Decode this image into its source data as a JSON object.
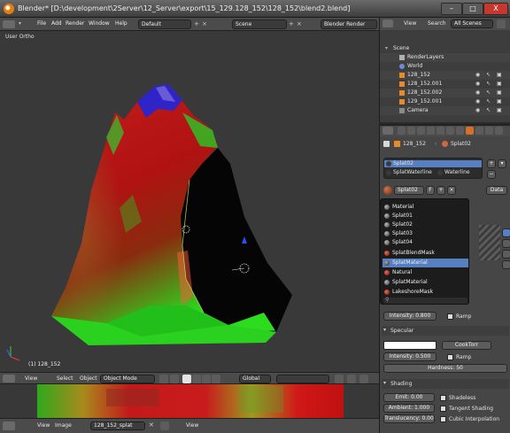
{
  "titlebar": {
    "title": "Blender* [D:\\development\\2Server\\12_Server\\export\\15_129.128_152\\128_152\\blend2.blend]",
    "minimize": "–",
    "maximize": "□",
    "close": "X"
  },
  "menubar": {
    "items": [
      "File",
      "Add",
      "Render",
      "Window",
      "Help"
    ],
    "layout": "Default",
    "scene": "Scene",
    "engine": "Blender Render"
  },
  "viewport": {
    "label": "User Ortho",
    "object_name": "(1) 128_152"
  },
  "view_header": {
    "view": "View",
    "select": "Select",
    "object": "Object",
    "mode": "Object Mode",
    "global": "Global"
  },
  "image_header": {
    "view": "View",
    "image": "Image",
    "image_name": "128_152_splat",
    "view2": "View"
  },
  "outliner": {
    "header": {
      "search": "Search",
      "filter": "All Scenes",
      "view": "View"
    },
    "rows": [
      {
        "label": "Scene"
      },
      {
        "label": "RenderLayers"
      },
      {
        "label": "World"
      },
      {
        "label": "128_152"
      },
      {
        "label": "128_152.001"
      },
      {
        "label": "128_152.002"
      },
      {
        "label": "129_152.001"
      },
      {
        "label": "Camera"
      }
    ]
  },
  "properties": {
    "breadcrumb_object": "128_152",
    "breadcrumb_material": "Splat02",
    "slots": [
      "Splat02",
      "SplatWaterline",
      "Waterline"
    ],
    "material_field": "Splat02",
    "data_btn": "Data",
    "intensity": "Intensity: 0.800",
    "ramp": "Ramp",
    "specular_label": "Specular",
    "specular_shader": "CookTorr",
    "specular_intensity": "Intensity: 0.500",
    "hardness": "Hardness: 50",
    "shading_label": "Shading",
    "emit": "Emit: 0.00",
    "ambient": "Ambient: 1.000",
    "translucency": "Translucency: 0.000",
    "shadeless": "Shadeless",
    "tangent_shading": "Tangent Shading",
    "cubic": "Cubic Interpolation"
  },
  "material_list": [
    {
      "label": "Material",
      "active": false
    },
    {
      "label": "Splat01",
      "active": false
    },
    {
      "label": "Splat02",
      "active": false
    },
    {
      "label": "Splat03",
      "active": false
    },
    {
      "label": "Splat04",
      "active": false
    },
    {
      "label": "SplatBlendMask",
      "active": false
    },
    {
      "label": "SplatMaterial",
      "active": true
    },
    {
      "label": "Natural",
      "active": false
    },
    {
      "label": "SplatMaterial",
      "active": false
    },
    {
      "label": "LakeshoreMask",
      "active": false
    }
  ],
  "colors": {
    "accent_blue": "#5680c2",
    "blender_orange": "#e87d0d",
    "close_red": "#c8372d"
  }
}
